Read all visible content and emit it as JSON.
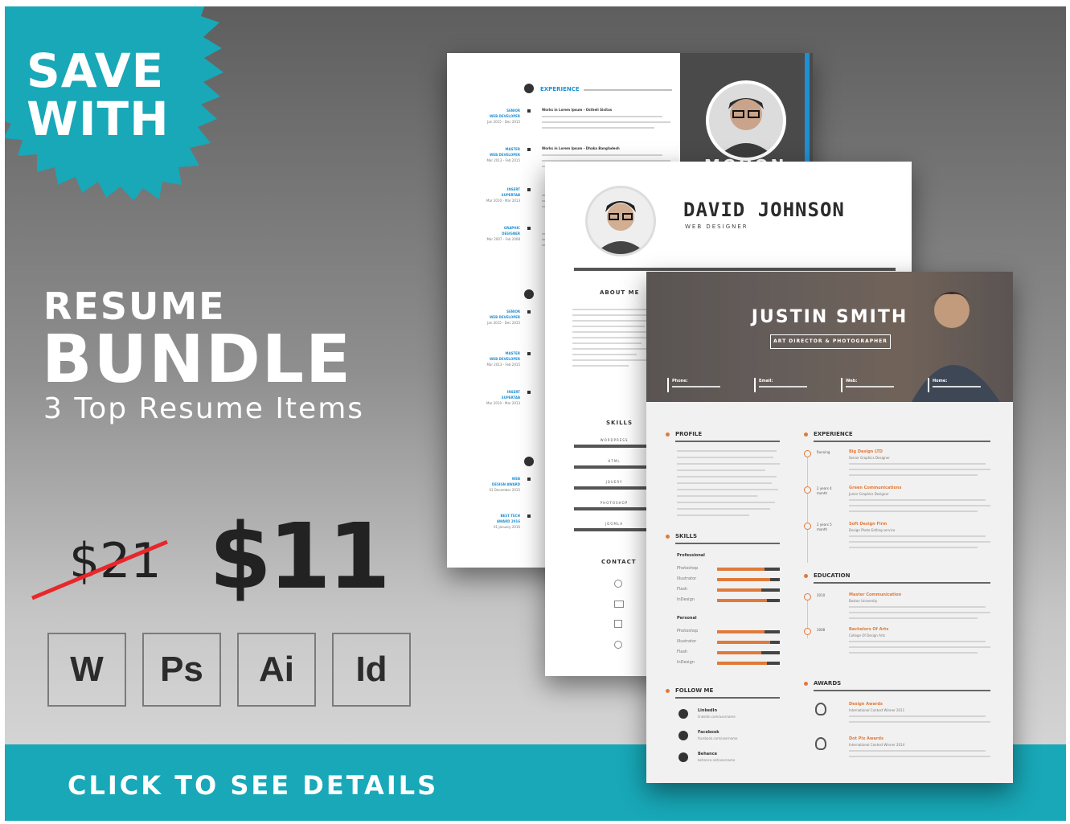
{
  "badge": {
    "line1": "SAVE",
    "line2": "WITH",
    "color": "#18a8b8"
  },
  "headline": {
    "resume": "RESUME",
    "bundle": "BUNDLE",
    "subtitle": "3 Top Resume Items"
  },
  "pricing": {
    "old_price": "$21",
    "new_price": "$11"
  },
  "apps": [
    {
      "label": "W",
      "icon": "word-icon"
    },
    {
      "label": "Ps",
      "icon": "photoshop-icon"
    },
    {
      "label": "Ai",
      "icon": "illustrator-icon"
    },
    {
      "label": "Id",
      "icon": "indesign-icon"
    }
  ],
  "cta": {
    "label": "CLICK TO SEE DETAILS",
    "color": "#18a8b8"
  },
  "resume1": {
    "section_experience": "EXPERIENCE",
    "name_partial": "MOHON",
    "left_titles": [
      [
        "SENIOR",
        "WEB DEVELOPER",
        "Jan 2015 - Dec 2015"
      ],
      [
        "MASTER",
        "WEB DEVELOPER",
        "Mar 2013 - Feb 2015"
      ],
      [
        "INSERT",
        "SUPERTAB",
        "Mar 2010 - Mar 2013"
      ],
      [
        "GRAPHIC",
        "DESIGNER",
        "Mar 2007 - Feb 2008"
      ]
    ],
    "right_titles": [
      "Works in Lorem Ipsum - Ostheli Sisitas",
      "Works in Lorem Ipsum - Dhaka Bangladesh"
    ],
    "lower_titles": [
      [
        "SENIOR",
        "WEB DEVELOPER",
        "Jan 2015 - Dec 2015"
      ],
      [
        "MASTER",
        "WEB DEVELOPER",
        "Mar 2013 - Feb 2015"
      ],
      [
        "INSERT",
        "SUPERTAB",
        "Mar 2010 - Mar 2013"
      ],
      [
        "WEB",
        "DESIGN AWARD",
        "01 December 2015"
      ],
      [
        "BEST TECH",
        "AWARD 2016",
        "01 January 2016"
      ]
    ]
  },
  "resume2": {
    "name": "DAVID JOHNSON",
    "title": "WEB DESIGNER",
    "about": "ABOUT ME",
    "skills": "SKILLS",
    "skill_items": [
      "WORDPRESS",
      "HTML",
      "JQUERY",
      "PHOTOSHOP",
      "JOOMLA"
    ],
    "contact": "CONTACT"
  },
  "resume3": {
    "name": "JUSTIN SMITH",
    "title": "ART DIRECTOR & PHOTOGRAPHER",
    "header_fields": [
      "Phone:",
      "Email:",
      "Web:",
      "Home:"
    ],
    "profile": "PROFILE",
    "skills": "SKILLS",
    "skills_professional": "Professional",
    "skills_personal": "Personal",
    "skill_names": [
      "Photoshop",
      "Illustrator",
      "Flash",
      "InDesign"
    ],
    "follow": "FOLLOW ME",
    "social": [
      [
        "LinkedIn",
        "linkedin.com/username"
      ],
      [
        "Facebook",
        "facebook.com/username"
      ],
      [
        "Behance",
        "behance.net/username"
      ]
    ],
    "experience": "EXPERIENCE",
    "exp_items": [
      [
        "Running",
        "Big Design LTD",
        "Senior Graphics Designer"
      ],
      [
        "2 years 4 month",
        "Green Communications",
        "Junior Graphics Designer"
      ],
      [
        "2 years 5 month",
        "Soft Design Firm",
        "Design Photo Editing service"
      ]
    ],
    "education": "EDUCATION",
    "edu_items": [
      [
        "2010",
        "Master Communication",
        "Boston University"
      ],
      [
        "2008",
        "Bachelors Of Arts",
        "College Of Design Arts"
      ]
    ],
    "awards": "AWARDS",
    "award_items": [
      [
        "Design Awards",
        "International Contest Winner 2011"
      ],
      [
        "Dot Pix Awards",
        "International Contest Winner 2014"
      ]
    ]
  }
}
